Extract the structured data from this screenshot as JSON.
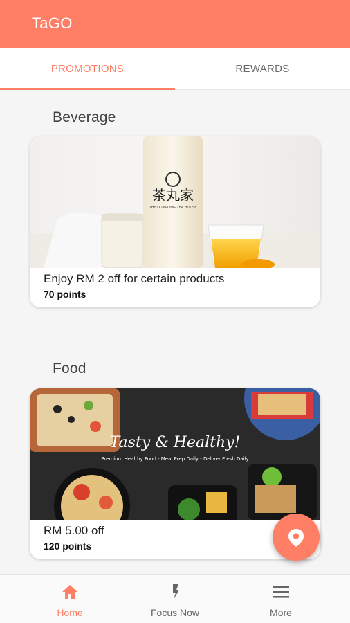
{
  "app": {
    "title": "TaGO"
  },
  "tabs": [
    {
      "label": "PROMOTIONS",
      "active": true
    },
    {
      "label": "REWARDS",
      "active": false
    }
  ],
  "sections": [
    {
      "title": "Beverage",
      "card": {
        "offer": "Enjoy RM 2 off for certain products",
        "points": "70 points",
        "image_brand_text": "茶丸家"
      }
    },
    {
      "title": "Food",
      "card": {
        "offer": "RM 5.00 off",
        "points": "120 points",
        "image_headline": "Tasty & Healthy!",
        "image_tagline": "Premium Healthy Food - Meal Prep Daily - Deliver Fresh Daily"
      }
    }
  ],
  "bottom_nav": [
    {
      "label": "Home",
      "icon": "home-icon",
      "active": true
    },
    {
      "label": "Focus Now",
      "icon": "lightning-icon",
      "active": false
    },
    {
      "label": "More",
      "icon": "menu-icon",
      "active": false
    }
  ],
  "fab": {
    "icon": "location-pin-icon"
  },
  "colors": {
    "accent": "#ff7f66",
    "inactive": "#6b6b6b",
    "background": "#f5f5f5"
  }
}
